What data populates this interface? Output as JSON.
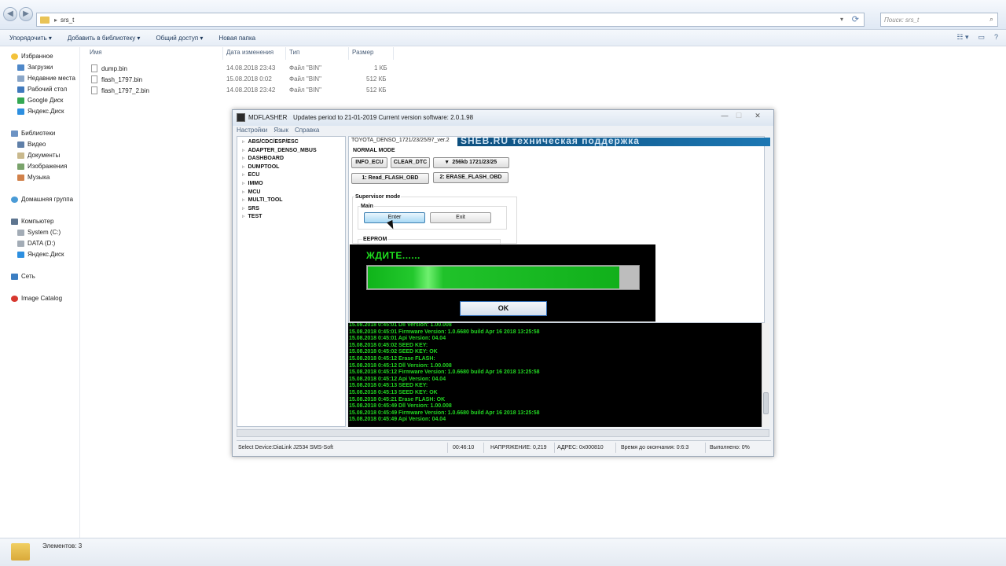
{
  "explorer": {
    "address_path": "srs_t",
    "search_placeholder": "Поиск: srs_t",
    "toolbar": [
      "Упорядочить ▾",
      "Добавить в библиотеку ▾",
      "Общий доступ ▾",
      "Новая папка"
    ],
    "nav_favorites": "Избранное",
    "nav_fav_items": [
      "Загрузки",
      "Недавние места",
      "Рабочий стол",
      "Google Диск",
      "Яндекс.Диск"
    ],
    "nav_libraries": "Библиотеки",
    "nav_lib_items": [
      "Видео",
      "Документы",
      "Изображения",
      "Музыка"
    ],
    "nav_homegroup": "Домашняя группа",
    "nav_computer": "Компьютер",
    "nav_comp_items": [
      "System (C:)",
      "DATA (D:)",
      "Яндекс.Диск"
    ],
    "nav_network": "Сеть",
    "nav_image_catalog": "Image Catalog",
    "columns": {
      "name": "Имя",
      "date": "Дата изменения",
      "type": "Тип",
      "size": "Размер"
    },
    "files": [
      {
        "name": "dump.bin",
        "date": "14.08.2018 23:43",
        "type": "Файл \"BIN\"",
        "size": "1 КБ"
      },
      {
        "name": "flash_1797.bin",
        "date": "15.08.2018 0:02",
        "type": "Файл \"BIN\"",
        "size": "512 КБ"
      },
      {
        "name": "flash_1797_2.bin",
        "date": "14.08.2018 23:42",
        "type": "Файл \"BIN\"",
        "size": "512 КБ"
      }
    ],
    "status_count": "Элементов: 3"
  },
  "app": {
    "title": "MDFLASHER",
    "subtitle": "Updates period to 21-01-2019  Current version software: 2.0.1.98",
    "menu": [
      "Настройки",
      "Язык",
      "Справка"
    ],
    "tree": [
      "ABS/CDC/ESP/ESC",
      "ADAPTER_DENSO_MBUS",
      "DASHBOARD",
      "DUMPTOOL",
      "ECU",
      "IMMO",
      "MCU",
      "MULTI_TOOL",
      "SRS",
      "TEST"
    ],
    "tab_label": "TOYOTA_DENSO_1721/23/25/97_ver.2",
    "banner_text": "SHEB.RU техническая поддержка",
    "normal_mode": "NORMAL MODE",
    "btn_info": "INFO_ECU",
    "btn_clear": "CLEAR_DTC",
    "dropdown_value": "256kb 1721/23/25",
    "btn_read": "1: Read_FLASH_OBD",
    "btn_erase": "2: ERASE_FLASH_OBD",
    "supervisor": "Supervisor mode",
    "main_group": "Main",
    "btn_enter": "Enter",
    "btn_exit": "Exit",
    "eeprom": "EEPROM",
    "log": [
      "15.08.2018 0:45:01  Dll Version:  1.00.008",
      "15.08.2018 0:45:01  Firmware Version:  1.0.6680 build Apr 16 2018 13:25:58",
      "15.08.2018 0:45:01  Api Version:  04.04",
      "15.08.2018 0:45:02  SEED KEY:",
      "15.08.2018 0:45:02  SEED KEY:   OK",
      "15.08.2018 0:45:12  Erase FLASH:",
      "15.08.2018 0:45:12  Dll Version:  1.00.008",
      "15.08.2018 0:45:12  Firmware Version:  1.0.6680 build Apr 16 2018 13:25:58",
      "15.08.2018 0:45:12  Api Version:  04.04",
      "15.08.2018 0:45:13  SEED KEY:",
      "15.08.2018 0:45:13  SEED KEY:   OK",
      "15.08.2018 0:45:21  Erase FLASH:  OK",
      "15.08.2018 0:45:49  Dll Version:  1.00.008",
      "15.08.2018 0:45:49  Firmware Version:  1.0.6680 build Apr 16 2018 13:25:58",
      "15.08.2018 0:45:49  Api Version:  04.04"
    ],
    "status": {
      "device": "Select Device:DiaLink J2534  SMS-Soft",
      "time": "00:46:10",
      "voltage": "НАПРЯЖЕНИЕ:  0,219",
      "address": "АДРЕС: 0x000810",
      "remaining": "Время до окончания: 0:6:3",
      "done": "Выполнено: 0%"
    },
    "popup": {
      "wait": "ЖДИТЕ......",
      "ok": "OK",
      "progress": 0.93
    }
  }
}
